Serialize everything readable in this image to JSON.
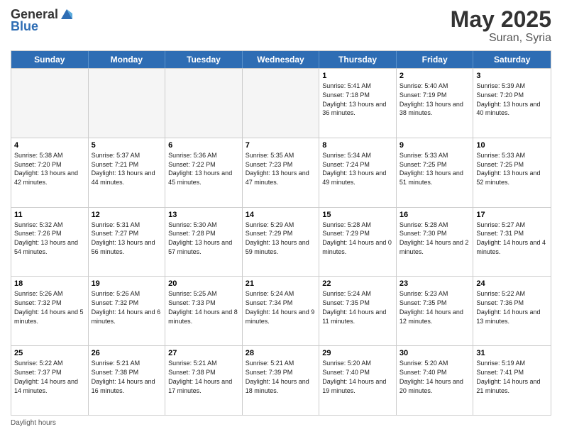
{
  "header": {
    "logo_general": "General",
    "logo_blue": "Blue",
    "title": "May 2025",
    "location": "Suran, Syria"
  },
  "days_of_week": [
    "Sunday",
    "Monday",
    "Tuesday",
    "Wednesday",
    "Thursday",
    "Friday",
    "Saturday"
  ],
  "weeks": [
    [
      {
        "day": "",
        "empty": true
      },
      {
        "day": "",
        "empty": true
      },
      {
        "day": "",
        "empty": true
      },
      {
        "day": "",
        "empty": true
      },
      {
        "day": "1",
        "sunrise": "5:41 AM",
        "sunset": "7:18 PM",
        "daylight": "13 hours and 36 minutes."
      },
      {
        "day": "2",
        "sunrise": "5:40 AM",
        "sunset": "7:19 PM",
        "daylight": "13 hours and 38 minutes."
      },
      {
        "day": "3",
        "sunrise": "5:39 AM",
        "sunset": "7:20 PM",
        "daylight": "13 hours and 40 minutes."
      }
    ],
    [
      {
        "day": "4",
        "sunrise": "5:38 AM",
        "sunset": "7:20 PM",
        "daylight": "13 hours and 42 minutes."
      },
      {
        "day": "5",
        "sunrise": "5:37 AM",
        "sunset": "7:21 PM",
        "daylight": "13 hours and 44 minutes."
      },
      {
        "day": "6",
        "sunrise": "5:36 AM",
        "sunset": "7:22 PM",
        "daylight": "13 hours and 45 minutes."
      },
      {
        "day": "7",
        "sunrise": "5:35 AM",
        "sunset": "7:23 PM",
        "daylight": "13 hours and 47 minutes."
      },
      {
        "day": "8",
        "sunrise": "5:34 AM",
        "sunset": "7:24 PM",
        "daylight": "13 hours and 49 minutes."
      },
      {
        "day": "9",
        "sunrise": "5:33 AM",
        "sunset": "7:25 PM",
        "daylight": "13 hours and 51 minutes."
      },
      {
        "day": "10",
        "sunrise": "5:33 AM",
        "sunset": "7:25 PM",
        "daylight": "13 hours and 52 minutes."
      }
    ],
    [
      {
        "day": "11",
        "sunrise": "5:32 AM",
        "sunset": "7:26 PM",
        "daylight": "13 hours and 54 minutes."
      },
      {
        "day": "12",
        "sunrise": "5:31 AM",
        "sunset": "7:27 PM",
        "daylight": "13 hours and 56 minutes."
      },
      {
        "day": "13",
        "sunrise": "5:30 AM",
        "sunset": "7:28 PM",
        "daylight": "13 hours and 57 minutes."
      },
      {
        "day": "14",
        "sunrise": "5:29 AM",
        "sunset": "7:29 PM",
        "daylight": "13 hours and 59 minutes."
      },
      {
        "day": "15",
        "sunrise": "5:28 AM",
        "sunset": "7:29 PM",
        "daylight": "14 hours and 0 minutes."
      },
      {
        "day": "16",
        "sunrise": "5:28 AM",
        "sunset": "7:30 PM",
        "daylight": "14 hours and 2 minutes."
      },
      {
        "day": "17",
        "sunrise": "5:27 AM",
        "sunset": "7:31 PM",
        "daylight": "14 hours and 4 minutes."
      }
    ],
    [
      {
        "day": "18",
        "sunrise": "5:26 AM",
        "sunset": "7:32 PM",
        "daylight": "14 hours and 5 minutes."
      },
      {
        "day": "19",
        "sunrise": "5:26 AM",
        "sunset": "7:32 PM",
        "daylight": "14 hours and 6 minutes."
      },
      {
        "day": "20",
        "sunrise": "5:25 AM",
        "sunset": "7:33 PM",
        "daylight": "14 hours and 8 minutes."
      },
      {
        "day": "21",
        "sunrise": "5:24 AM",
        "sunset": "7:34 PM",
        "daylight": "14 hours and 9 minutes."
      },
      {
        "day": "22",
        "sunrise": "5:24 AM",
        "sunset": "7:35 PM",
        "daylight": "14 hours and 11 minutes."
      },
      {
        "day": "23",
        "sunrise": "5:23 AM",
        "sunset": "7:35 PM",
        "daylight": "14 hours and 12 minutes."
      },
      {
        "day": "24",
        "sunrise": "5:22 AM",
        "sunset": "7:36 PM",
        "daylight": "14 hours and 13 minutes."
      }
    ],
    [
      {
        "day": "25",
        "sunrise": "5:22 AM",
        "sunset": "7:37 PM",
        "daylight": "14 hours and 14 minutes."
      },
      {
        "day": "26",
        "sunrise": "5:21 AM",
        "sunset": "7:38 PM",
        "daylight": "14 hours and 16 minutes."
      },
      {
        "day": "27",
        "sunrise": "5:21 AM",
        "sunset": "7:38 PM",
        "daylight": "14 hours and 17 minutes."
      },
      {
        "day": "28",
        "sunrise": "5:21 AM",
        "sunset": "7:39 PM",
        "daylight": "14 hours and 18 minutes."
      },
      {
        "day": "29",
        "sunrise": "5:20 AM",
        "sunset": "7:40 PM",
        "daylight": "14 hours and 19 minutes."
      },
      {
        "day": "30",
        "sunrise": "5:20 AM",
        "sunset": "7:40 PM",
        "daylight": "14 hours and 20 minutes."
      },
      {
        "day": "31",
        "sunrise": "5:19 AM",
        "sunset": "7:41 PM",
        "daylight": "14 hours and 21 minutes."
      }
    ]
  ],
  "footer": {
    "daylight_hours": "Daylight hours"
  }
}
